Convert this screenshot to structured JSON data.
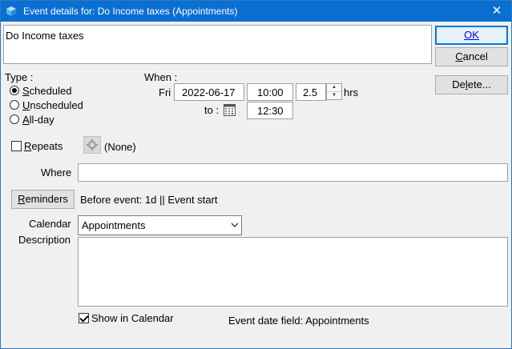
{
  "window": {
    "title": "Event details for: Do Income taxes (Appointments)"
  },
  "event_name": "Do Income taxes",
  "buttons": {
    "ok": "OK",
    "cancel": "Cancel",
    "delete": "Delete..."
  },
  "type": {
    "label": "Type :",
    "options": [
      "Scheduled",
      "Unscheduled",
      "All-day"
    ],
    "selected": "Scheduled"
  },
  "when": {
    "label": "When :",
    "day": "Fri",
    "date": "2022-06-17",
    "start_time": "10:00",
    "duration": "2.5",
    "duration_unit": "hrs",
    "to_label": "to :",
    "end_time": "12:30"
  },
  "repeats": {
    "label": "Repeats",
    "checked": false,
    "value": "(None)"
  },
  "where": {
    "label": "Where",
    "value": ""
  },
  "reminders": {
    "button": "Reminders",
    "text": "Before event: 1d || Event start"
  },
  "calendar": {
    "label": "Calendar",
    "value": "Appointments"
  },
  "description": {
    "label": "Description",
    "value": ""
  },
  "show_in_calendar": {
    "label": "Show in Calendar",
    "checked": true
  },
  "event_date_field": "Event date field: Appointments",
  "colors": {
    "titlebar": "#0a6fd1",
    "accent": "#0078d7"
  }
}
